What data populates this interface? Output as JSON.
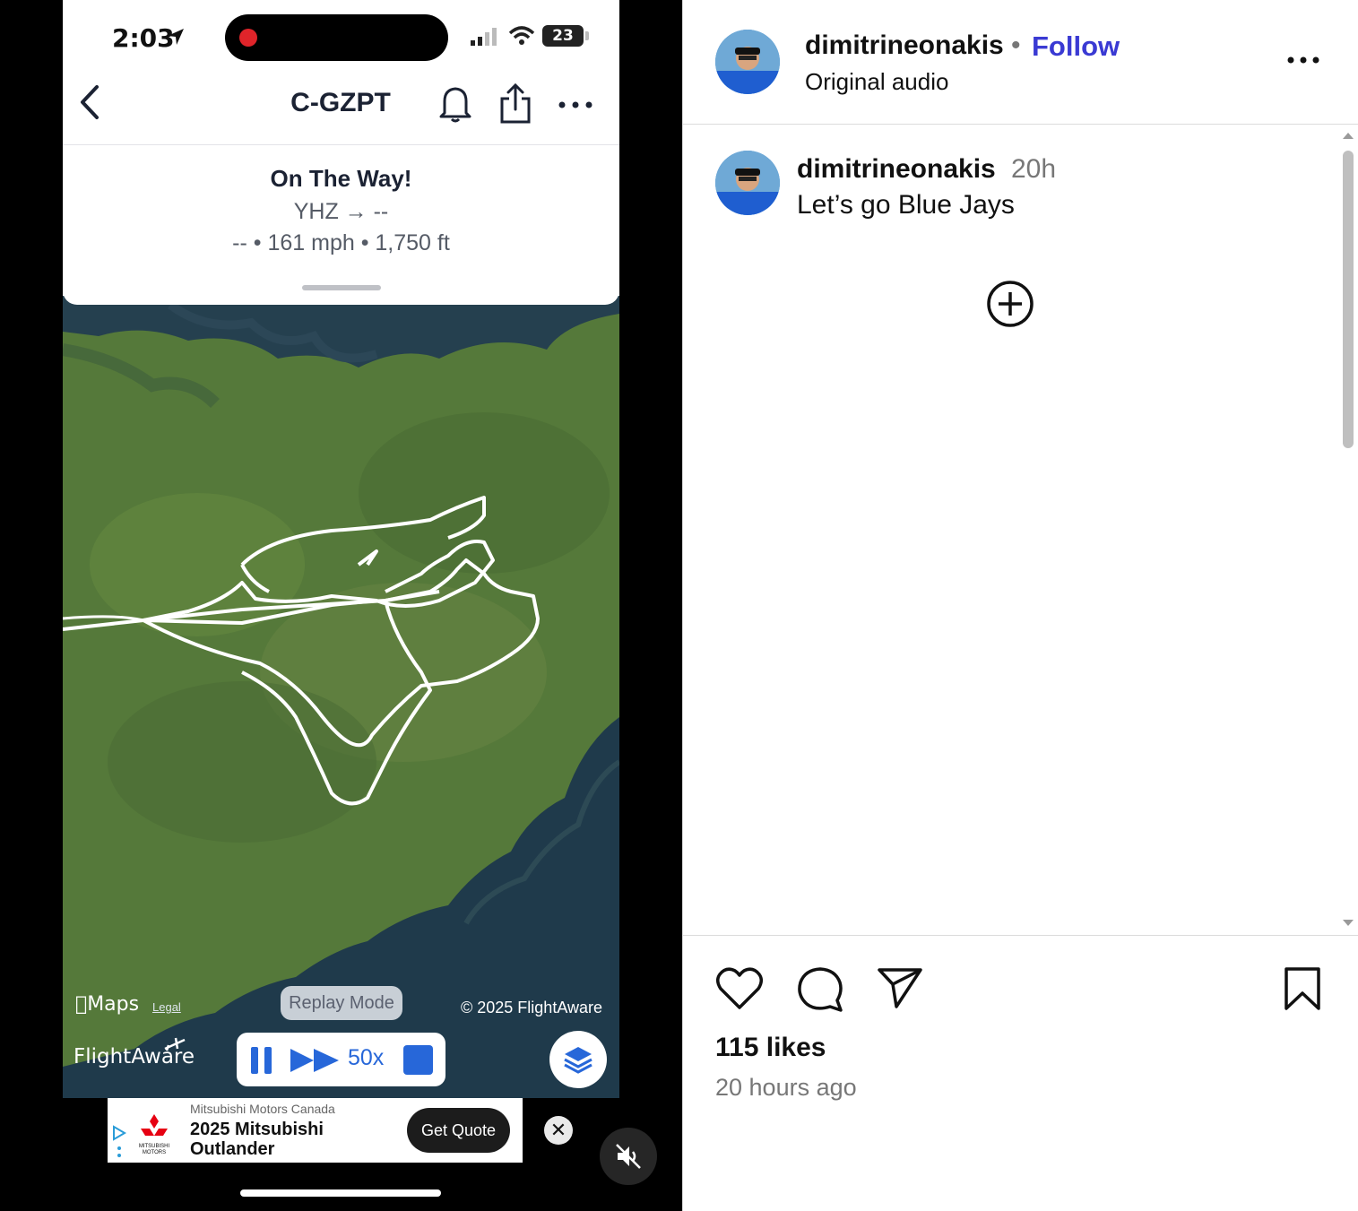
{
  "status_bar": {
    "time": "2:03",
    "battery": "23"
  },
  "app": {
    "tail_number": "C-GZPT",
    "flight_status": "On The Way!",
    "route": "YHZ → --",
    "stats": "-- • 161 mph • 1,750 ft"
  },
  "map": {
    "maps_credit": "Maps",
    "legal": "Legal",
    "replay_mode": "Replay Mode",
    "copyright": "© 2025 FlightAware",
    "brand": "FlightAware",
    "playback_speed": "50x"
  },
  "ad": {
    "sponsor": "Mitsubishi Motors Canada",
    "headline": "2025 Mitsubishi Outlander",
    "cta": "Get Quote",
    "logo_text": "MITSUBISHI MOTORS",
    "close": "✕"
  },
  "post": {
    "username": "dimitrineonakis",
    "separator": "•",
    "follow": "Follow",
    "audio": "Original audio",
    "caption": {
      "username": "dimitrineonakis",
      "time": "20h",
      "text": "Let’s go Blue Jays"
    },
    "likes": "115 likes",
    "posted": "20 hours ago"
  },
  "colors": {
    "follow_blue": "#3a3ad3",
    "flightaware_blue": "#2767d9",
    "recording_red": "#e0242a"
  },
  "icons": [
    "back-icon",
    "bell-icon",
    "share-icon",
    "more-icon",
    "pause-icon",
    "fast-forward-icon",
    "stop-icon",
    "layers-icon",
    "mute-icon",
    "options-icon",
    "add-circle-icon",
    "heart-icon",
    "comment-icon",
    "send-icon",
    "bookmark-icon"
  ]
}
